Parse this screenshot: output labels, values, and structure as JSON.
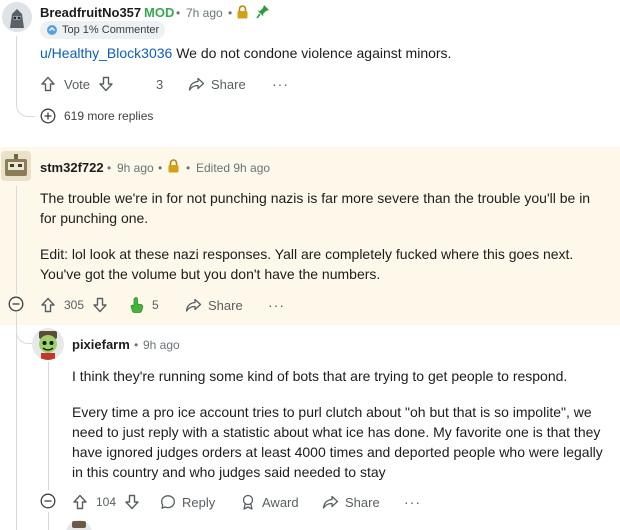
{
  "comment1": {
    "author": "BreadfruitNo357",
    "mod_label": "MOD",
    "time": "7h ago",
    "flair": "Top 1% Commenter",
    "mention": "u/Healthy_Block3036",
    "body": " We do not condone violence against minors.",
    "vote_label": "Vote",
    "count": "3",
    "share_label": "Share",
    "more_replies": "619 more replies"
  },
  "comment2": {
    "author": "stm32f722",
    "time": "9h ago",
    "edited": "Edited 9h ago",
    "para1": "The trouble we're in for not punching nazis is far more severe than the trouble you'll be in for punching one.",
    "para2": "Edit: lol look at these nazi responses. Yall are completely fucked where this goes next. You've got the volume but you don't have the numbers.",
    "score": "305",
    "awards": "5",
    "share_label": "Share"
  },
  "comment3": {
    "author": "pixiefarm",
    "time": "9h ago",
    "para1": "I think they're running some kind of bots that are trying to get people to respond.",
    "para2": "Every time a pro ice account tries to purl clutch about \"oh but that is so impolite\", we need to just reply with a statistic about what ice has done. My favorite one is that they have ignored judges orders at least 4000 times and deported people who were legally in this country and who judges said needed to stay",
    "score": "104",
    "reply_label": "Reply",
    "award_label": "Award",
    "share_label": "Share"
  },
  "colors": {
    "mod_green": "#36a852",
    "link_blue": "#0b5ec2",
    "highlight": "#fdf8ea",
    "award_green": "#46b33e"
  },
  "icons": [
    "upvote-icon",
    "downvote-icon",
    "share-icon",
    "plus-circle-icon",
    "minus-circle-icon",
    "lock-icon",
    "pin-icon",
    "reply-icon",
    "award-icon",
    "more-icon"
  ]
}
